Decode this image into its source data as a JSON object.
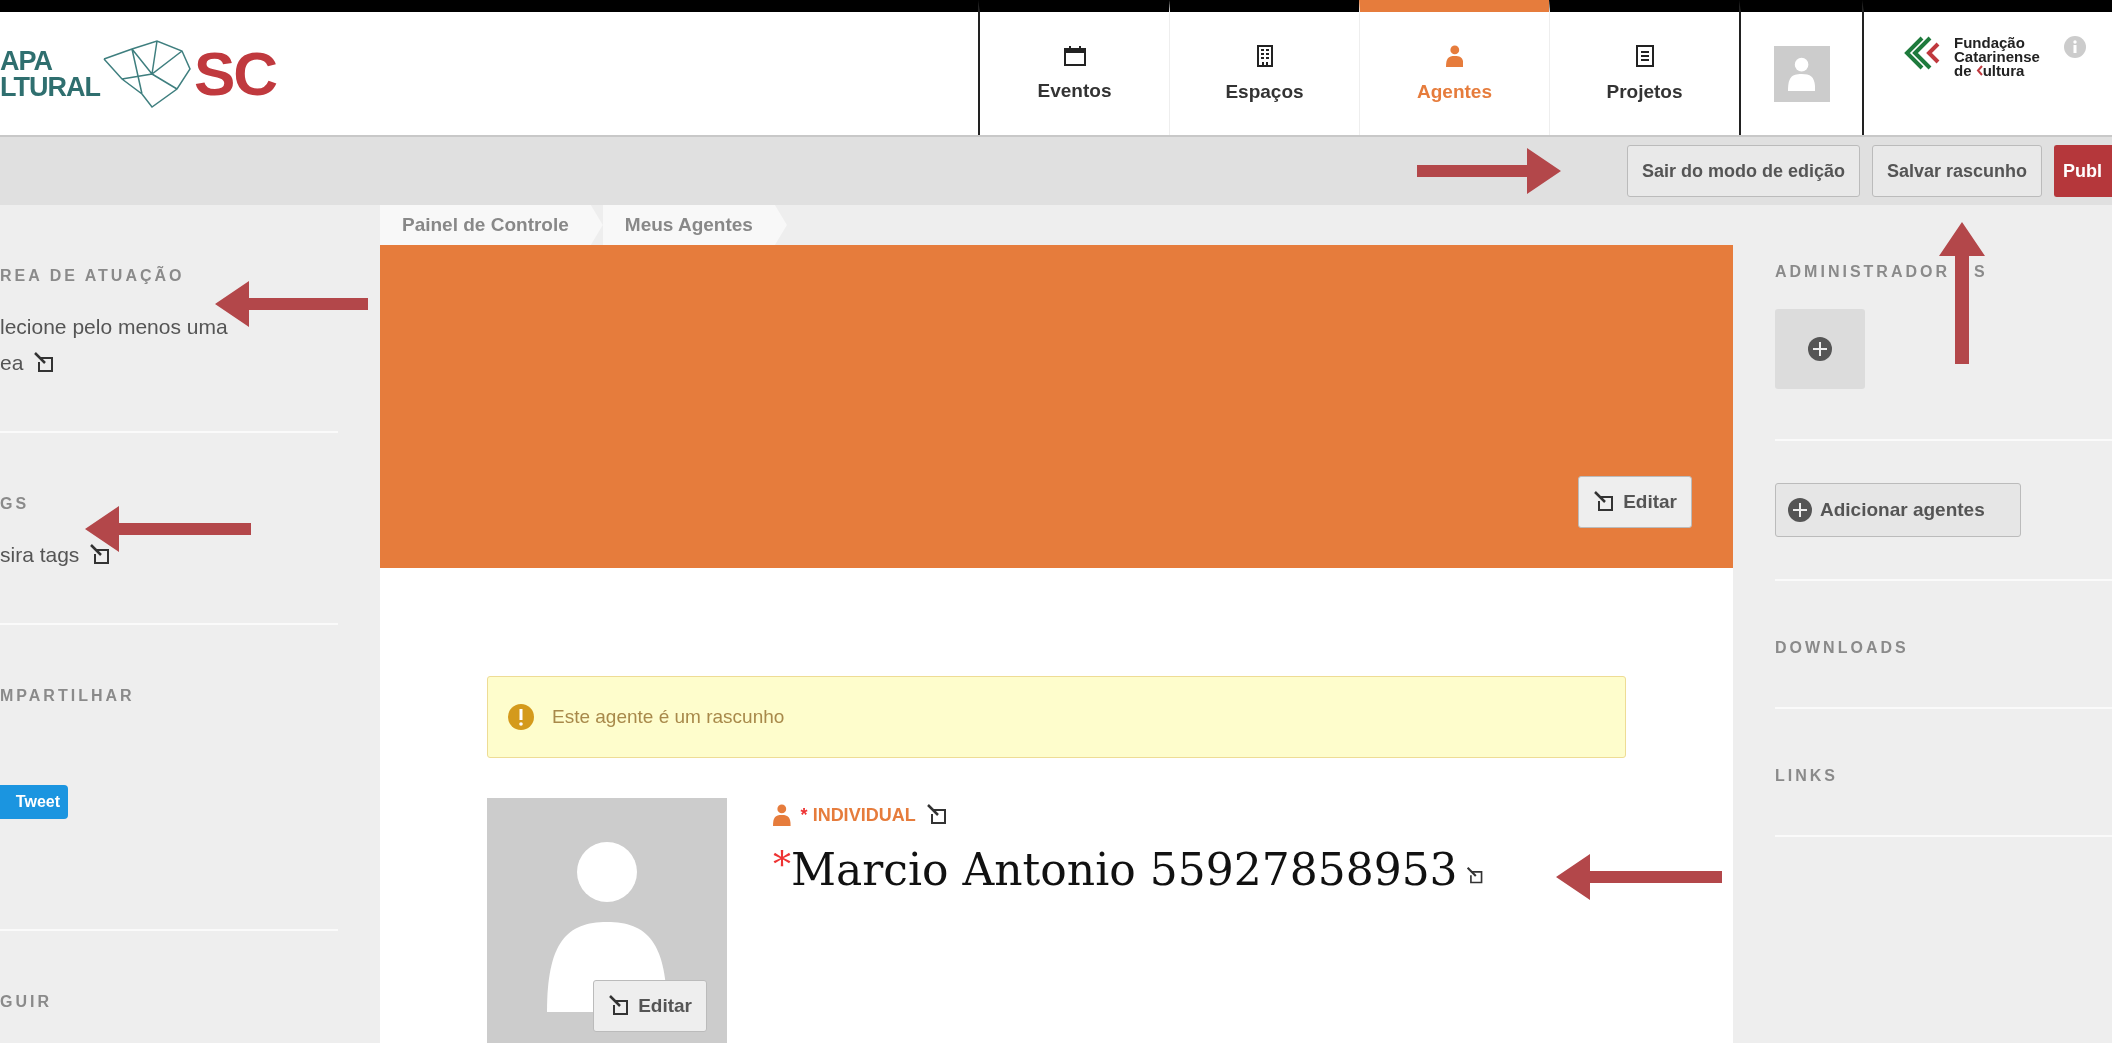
{
  "logo": {
    "lines": [
      "APA",
      "LTURAL"
    ],
    "mark": "SC"
  },
  "nav": [
    {
      "label": "Eventos",
      "selected": false
    },
    {
      "label": "Espaços",
      "selected": false
    },
    {
      "label": "Agentes",
      "selected": true
    },
    {
      "label": "Projetos",
      "selected": false
    }
  ],
  "org_logo": {
    "lines": [
      "Fundação",
      "Catarinense"
    ],
    "last_prefix": "de",
    "last_suffix": "ultura"
  },
  "toolbar": {
    "buttons": [
      {
        "label": "Sair do modo de edição",
        "kind": "plain"
      },
      {
        "label": "Salvar rascunho",
        "kind": "plain"
      },
      {
        "label": "Publ",
        "kind": "primary"
      }
    ]
  },
  "breadcrumb": [
    "Painel de Controle",
    "Meus Agentes"
  ],
  "left_sidebar": [
    {
      "heading": "REA DE ATUAÇÃO",
      "kind": "text",
      "text": [
        "lecione pelo menos uma",
        "ea"
      ]
    },
    {
      "heading": "GS",
      "kind": "text",
      "text": [
        "sira tags"
      ]
    },
    {
      "heading": "MPARTILHAR",
      "kind": "share",
      "button": "Tweet"
    },
    {
      "heading": "GUIR",
      "kind": "empty"
    }
  ],
  "cover": {
    "edit_button": "Editar"
  },
  "alert": "Este agente é um rascunho",
  "profile": {
    "avatar_edit": "Editar",
    "type_required": "*",
    "type": "INDIVIDUAL",
    "name_required": "*",
    "name": "Marcio Antonio 55927858953"
  },
  "right_sidebar": [
    {
      "heading_parts": [
        "ADMINISTRADOR",
        "S"
      ],
      "kind": "add-box"
    },
    {
      "kind": "button",
      "button": "Adicionar agentes"
    },
    {
      "heading": "DOWNLOADS",
      "kind": "empty"
    },
    {
      "heading": "LINKS",
      "kind": "empty"
    }
  ]
}
